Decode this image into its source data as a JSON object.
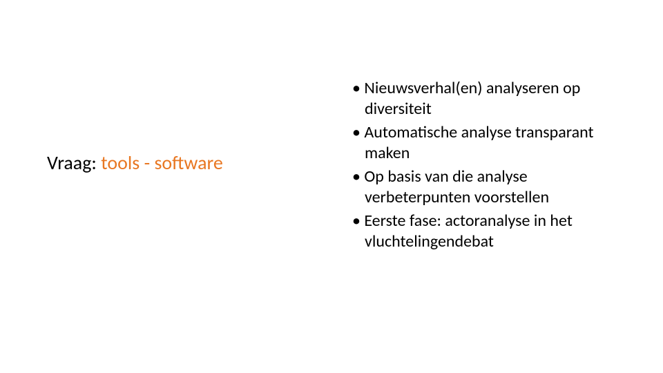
{
  "left": {
    "prefix": "Vraag: ",
    "highlight": "tools - software"
  },
  "bullets": {
    "item1": "Nieuwsverhal(en) analyseren op diversiteit",
    "item2": "Automatische analyse transparant maken",
    "item3": "Op basis van die analyse verbeterpunten voorstellen",
    "item4": "Eerste fase: actoranalyse in het vluchtelingendebat"
  }
}
